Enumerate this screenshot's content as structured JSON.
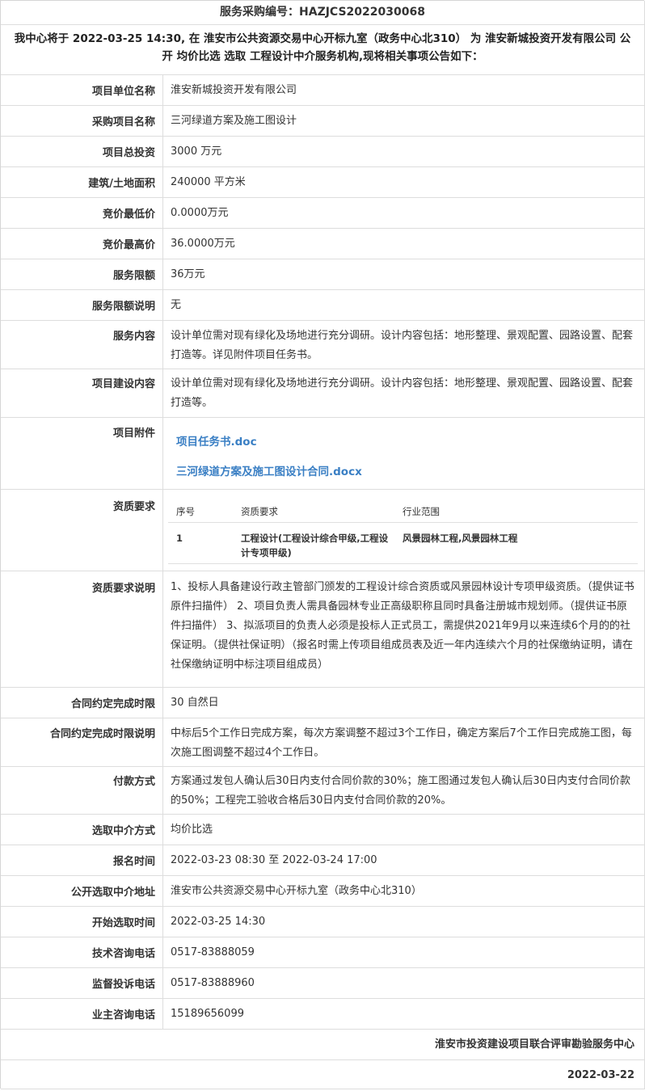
{
  "header": {
    "code_label": "服务采购编号：",
    "code": "HAZJCS2022030068",
    "intro": "我中心将于 2022-03-25 14:30, 在 淮安市公共资源交易中心开标九室（政务中心北310） 为 淮安新城投资开发有限公司 公开 均价比选 选取 工程设计中介服务机构,现将相关事项公告如下："
  },
  "rows": [
    {
      "label": "项目单位名称",
      "value": "淮安新城投资开发有限公司"
    },
    {
      "label": "采购项目名称",
      "value": "三河绿道方案及施工图设计"
    },
    {
      "label": "项目总投资",
      "value": "3000 万元"
    },
    {
      "label": "建筑/土地面积",
      "value": "240000 平方米"
    },
    {
      "label": "竞价最低价",
      "value": "0.0000万元"
    },
    {
      "label": "竞价最高价",
      "value": "36.0000万元"
    },
    {
      "label": "服务限额",
      "value": "36万元"
    },
    {
      "label": "服务限额说明",
      "value": "无"
    },
    {
      "label": "服务内容",
      "value": "设计单位需对现有绿化及场地进行充分调研。设计内容包括：地形整理、景观配置、园路设置、配套打造等。详见附件项目任务书。"
    },
    {
      "label": "项目建设内容",
      "value": "设计单位需对现有绿化及场地进行充分调研。设计内容包括：地形整理、景观配置、园路设置、配套打造等。"
    }
  ],
  "attachments": {
    "label": "项目附件",
    "files": [
      "项目任务书.doc",
      "三河绿道方案及施工图设计合同.docx"
    ]
  },
  "qualification": {
    "label": "资质要求",
    "headers": [
      "序号",
      "资质要求",
      "行业范围"
    ],
    "rows": [
      {
        "no": "1",
        "req": "工程设计(工程设计综合甲级,工程设计专项甲级)",
        "scope": "风景园林工程,风景园林工程"
      }
    ]
  },
  "rows2": [
    {
      "label": "资质要求说明",
      "value": "1、投标人具备建设行政主管部门颁发的工程设计综合资质或风景园林设计专项甲级资质。（提供证书原件扫描件） 2、项目负责人需具备园林专业正高级职称且同时具备注册城市规划师。（提供证书原件扫描件） 3、拟派项目的负责人必须是投标人正式员工，需提供2021年9月以来连续6个月的的社保证明。（提供社保证明）（报名时需上传项目组成员表及近一年内连续六个月的社保缴纳证明，请在社保缴纳证明中标注项目组成员）"
    },
    {
      "label": "合同约定完成时限",
      "value": "30 自然日"
    },
    {
      "label": "合同约定完成时限说明",
      "value": "中标后5个工作日完成方案，每次方案调整不超过3个工作日，确定方案后7个工作日完成施工图，每次施工图调整不超过4个工作日。"
    },
    {
      "label": "付款方式",
      "value": "方案通过发包人确认后30日内支付合同价款的30%；施工图通过发包人确认后30日内支付合同价款的50%；工程完工验收合格后30日内支付合同价款的20%。"
    },
    {
      "label": "选取中介方式",
      "value": "均价比选"
    },
    {
      "label": "报名时间",
      "value": "2022-03-23 08:30 至 2022-03-24 17:00"
    },
    {
      "label": "公开选取中介地址",
      "value": "淮安市公共资源交易中心开标九室（政务中心北310）"
    },
    {
      "label": "开始选取时间",
      "value": "2022-03-25 14:30"
    },
    {
      "label": "技术咨询电话",
      "value": "0517-83888059"
    },
    {
      "label": "监督投诉电话",
      "value": "0517-83888960"
    },
    {
      "label": "业主咨询电话",
      "value": "15189656099"
    }
  ],
  "footer": {
    "org": "淮安市投资建设项目联合评审勘验服务中心",
    "date": "2022-03-22"
  }
}
